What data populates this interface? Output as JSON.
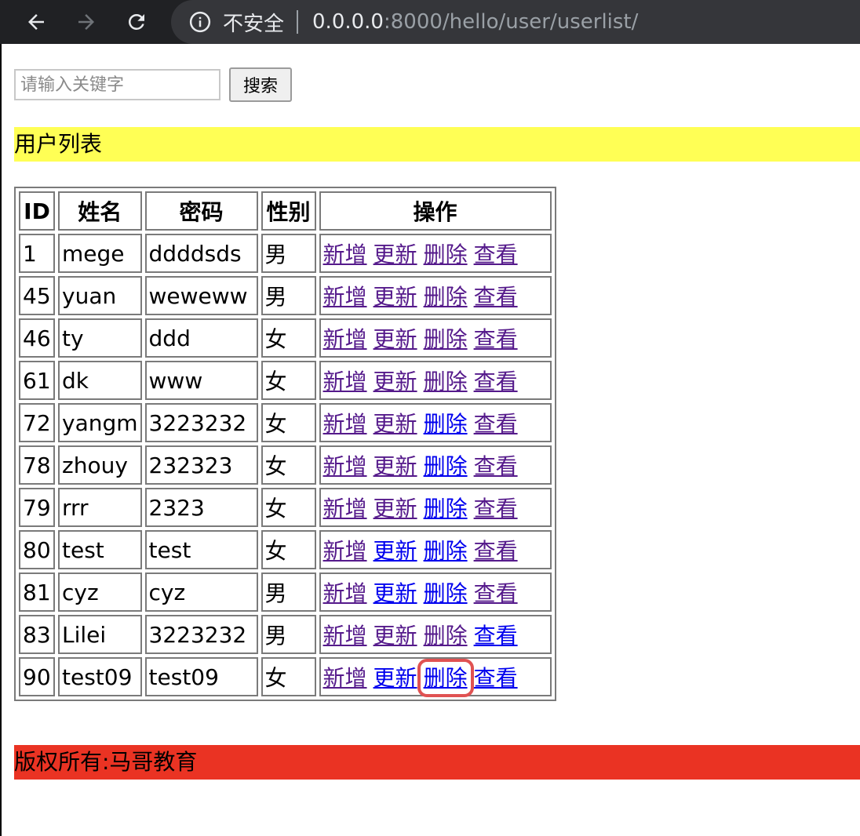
{
  "browser": {
    "security_label": "不安全",
    "url_host": "0.0.0.0",
    "url_rest": ":8000/hello/user/userlist/",
    "icons": [
      "back-arrow-icon",
      "forward-arrow-icon",
      "reload-icon",
      "info-icon"
    ]
  },
  "search": {
    "placeholder": "请输入关键字",
    "value": "",
    "button_label": "搜索"
  },
  "title": "用户列表",
  "footer": "版权所有:马哥教育",
  "table": {
    "headers": [
      "ID",
      "姓名",
      "密码",
      "性别",
      "操作"
    ],
    "actions": [
      "新增",
      "更新",
      "删除",
      "查看"
    ],
    "rows": [
      {
        "id": "1",
        "name": "mege",
        "password": "ddddsds",
        "gender": "男",
        "visited": [
          true,
          true,
          true,
          true
        ]
      },
      {
        "id": "45",
        "name": "yuan",
        "password": "weweww",
        "gender": "男",
        "visited": [
          true,
          true,
          true,
          true
        ]
      },
      {
        "id": "46",
        "name": "ty",
        "password": "ddd",
        "gender": "女",
        "visited": [
          true,
          true,
          true,
          true
        ]
      },
      {
        "id": "61",
        "name": "dk",
        "password": "www",
        "gender": "女",
        "visited": [
          true,
          true,
          true,
          true
        ]
      },
      {
        "id": "72",
        "name": "yangm",
        "password": "3223232",
        "gender": "女",
        "visited": [
          true,
          true,
          false,
          true
        ]
      },
      {
        "id": "78",
        "name": "zhouy",
        "password": "232323",
        "gender": "女",
        "visited": [
          true,
          true,
          false,
          true
        ]
      },
      {
        "id": "79",
        "name": "rrr",
        "password": "2323",
        "gender": "女",
        "visited": [
          true,
          true,
          false,
          true
        ]
      },
      {
        "id": "80",
        "name": "test",
        "password": "test",
        "gender": "女",
        "visited": [
          true,
          false,
          false,
          true
        ]
      },
      {
        "id": "81",
        "name": "cyz",
        "password": "cyz",
        "gender": "男",
        "visited": [
          true,
          false,
          false,
          true
        ]
      },
      {
        "id": "83",
        "name": "Lilei",
        "password": "3223232",
        "gender": "男",
        "visited": [
          true,
          true,
          true,
          false
        ]
      },
      {
        "id": "90",
        "name": "test09",
        "password": "test09",
        "gender": "女",
        "visited": [
          true,
          false,
          false,
          false
        ],
        "highlight_action": 2
      }
    ]
  },
  "colors": {
    "title_bg": "#ffff55",
    "footer_bg": "#ea3323",
    "link_visited": "#551a8b",
    "link_unvisited": "#0000ee",
    "highlight_outline": "#e05252"
  }
}
